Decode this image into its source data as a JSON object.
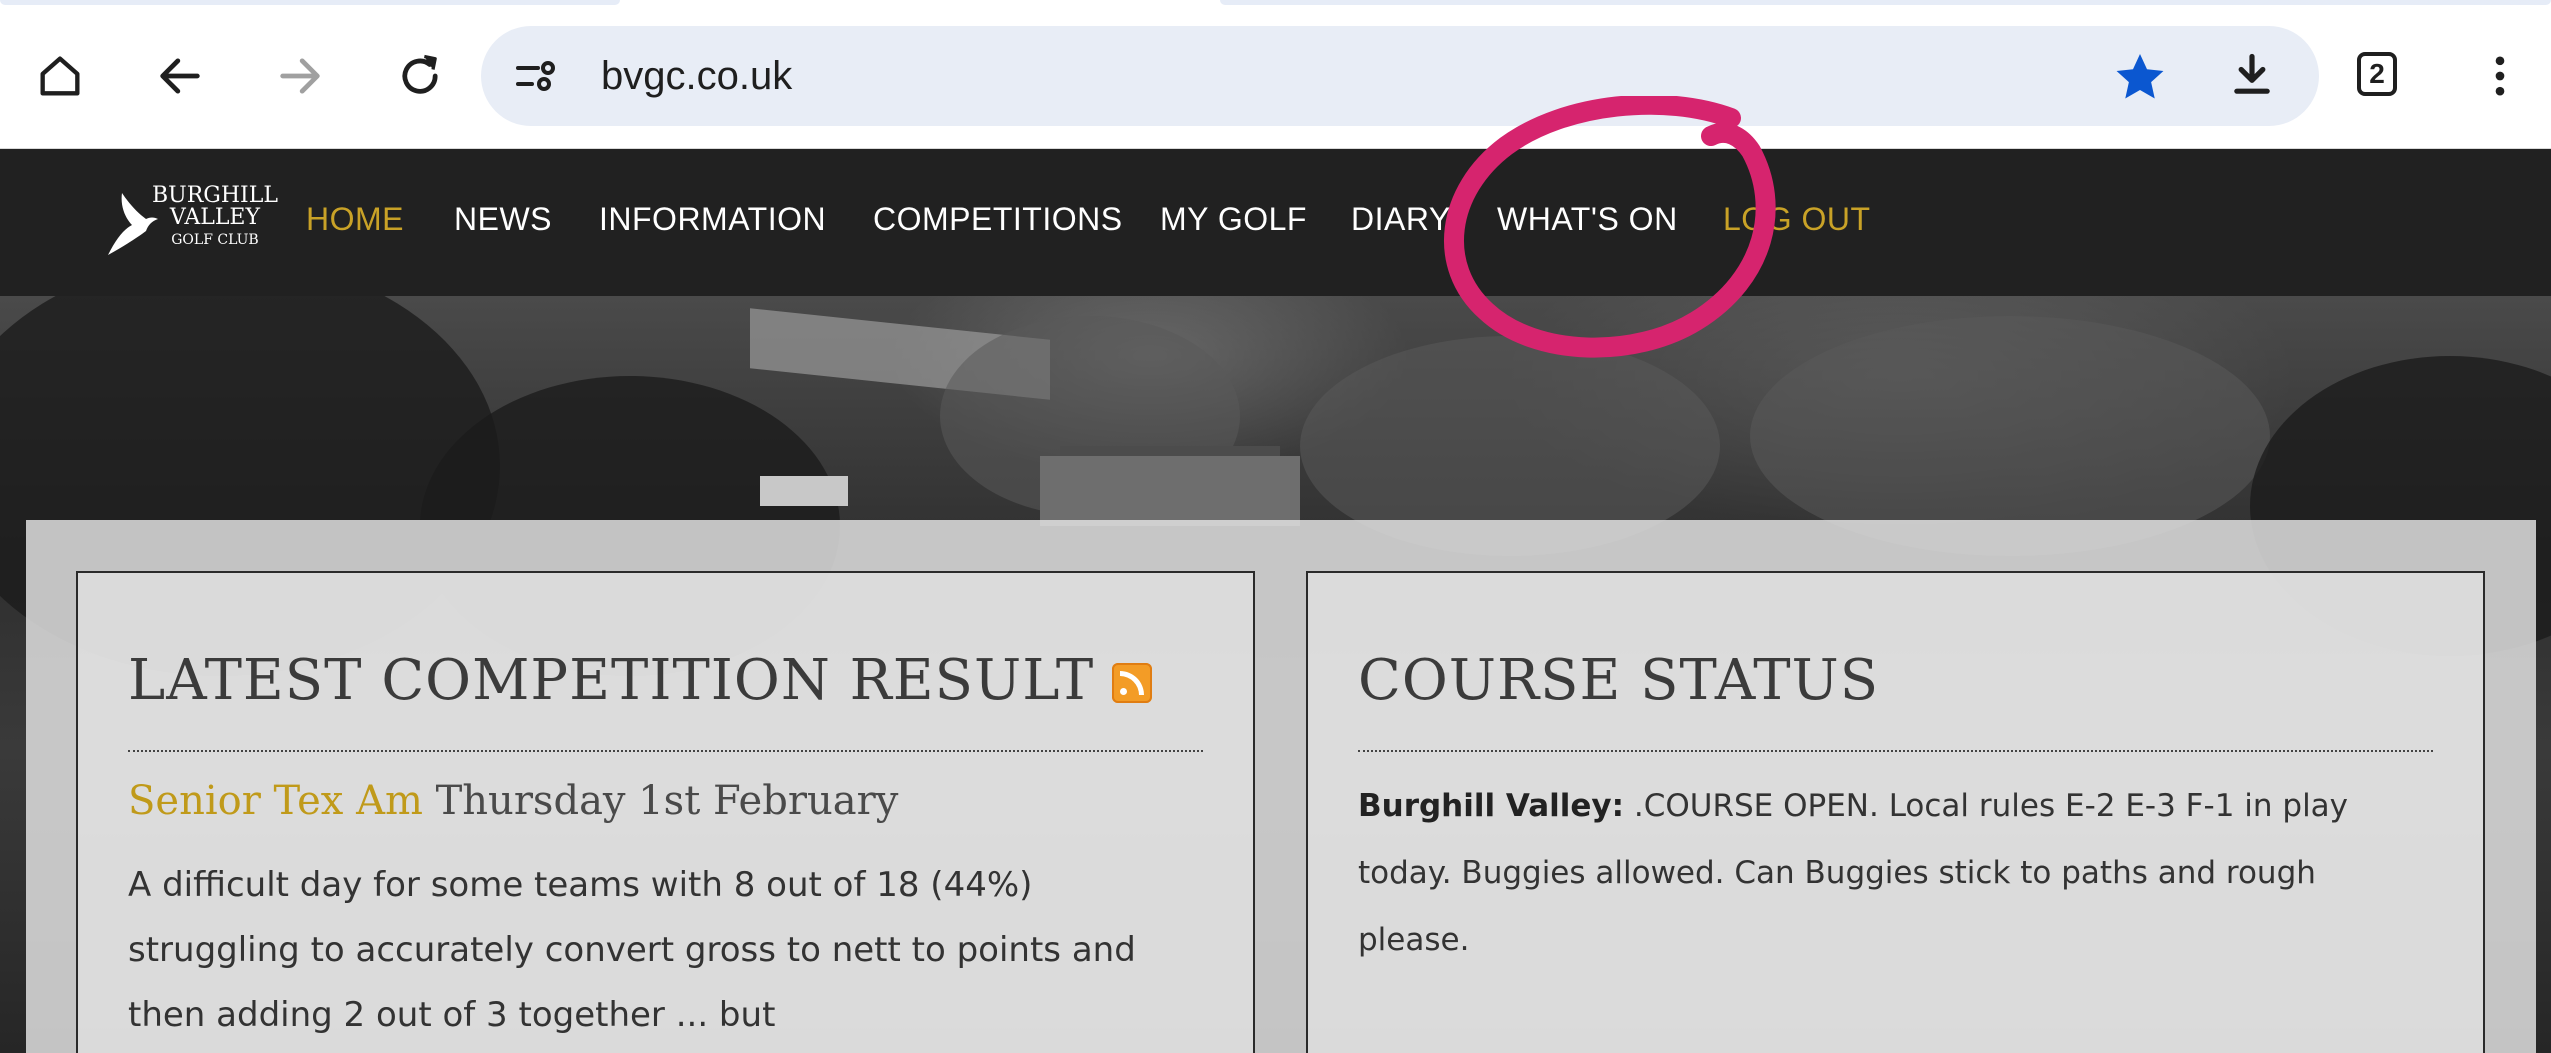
{
  "browser": {
    "url": "bvgc.co.uk",
    "tab_count": "2",
    "icons": [
      "home-icon",
      "back-icon",
      "forward-icon",
      "reload-icon",
      "site-info-icon",
      "bookmark-star-icon",
      "download-icon",
      "tab-switcher-icon",
      "menu-icon"
    ],
    "star_color": "#0b57d0"
  },
  "site_nav": {
    "logo": {
      "line1": "BURGHILL",
      "line2": "VALLEY",
      "line3": "GOLF CLUB"
    },
    "items": [
      {
        "label": "HOME",
        "active": true
      },
      {
        "label": "NEWS"
      },
      {
        "label": "INFORMATION"
      },
      {
        "label": "COMPETITIONS"
      },
      {
        "label": "MY GOLF"
      },
      {
        "label": "DIARY"
      },
      {
        "label": "WHAT'S ON"
      },
      {
        "label": "LOG OUT",
        "accent": true
      }
    ],
    "accent_color": "#c9a227",
    "background": "#212121"
  },
  "competition_panel": {
    "title": "LATEST COMPETITION RESULT",
    "competition_name": "Senior Tex Am",
    "competition_date": "Thursday 1st February",
    "summary": "A difficult day for some teams with 8 out of 18 (44%) struggling to accurately convert gross to nett to points and then adding 2 out of 3 together ... but"
  },
  "course_status_panel": {
    "title": "COURSE STATUS",
    "course_name": "Burghill Valley:",
    "status_text": " .COURSE OPEN. Local rules E-2 E-3 F-1 in play today. Buggies allowed. Can Buggies stick to paths and rough please."
  },
  "annotation": {
    "shape": "hand-drawn circle",
    "color": "#d6246e",
    "target": "WHAT'S ON"
  }
}
